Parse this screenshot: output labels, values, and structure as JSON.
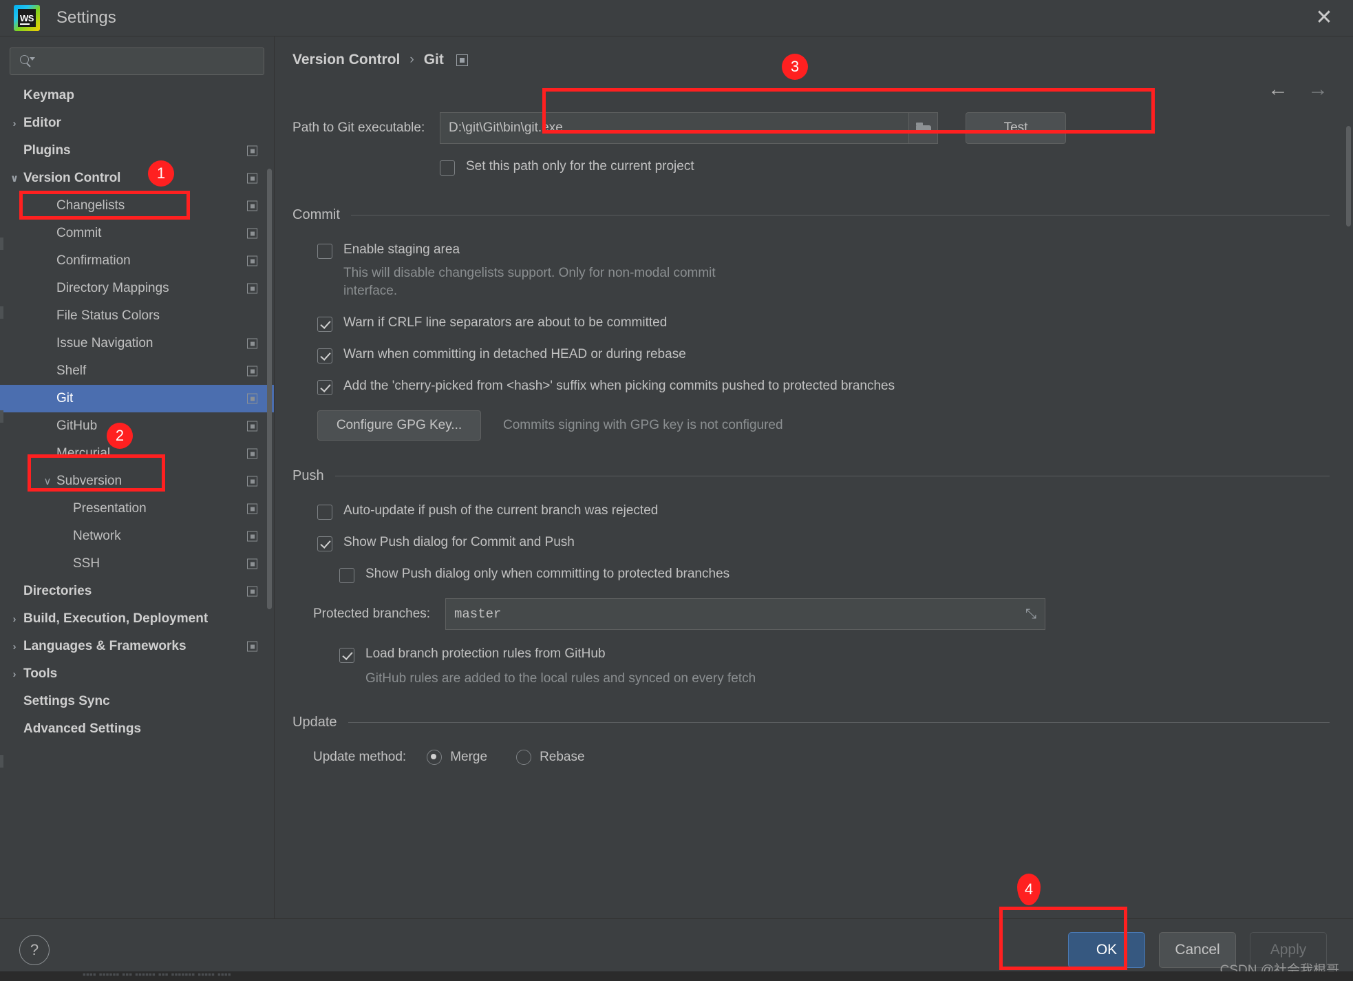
{
  "window": {
    "title": "Settings",
    "logo_text": "WS",
    "close_icon": "✕"
  },
  "sidebar": {
    "search": {
      "placeholder": "",
      "value": "",
      "icon": "search-icon"
    },
    "items": [
      {
        "label": "Keymap",
        "indent": 0,
        "arrow": "",
        "bold": true,
        "cfg": false,
        "selected": false
      },
      {
        "label": "Editor",
        "indent": 0,
        "arrow": "›",
        "bold": true,
        "cfg": false,
        "selected": false
      },
      {
        "label": "Plugins",
        "indent": 0,
        "arrow": "",
        "bold": true,
        "cfg": true,
        "selected": false
      },
      {
        "label": "Version Control",
        "indent": 0,
        "arrow": "∨",
        "bold": true,
        "cfg": true,
        "selected": false
      },
      {
        "label": "Changelists",
        "indent": 1,
        "arrow": "",
        "bold": false,
        "cfg": true,
        "selected": false
      },
      {
        "label": "Commit",
        "indent": 1,
        "arrow": "",
        "bold": false,
        "cfg": true,
        "selected": false
      },
      {
        "label": "Confirmation",
        "indent": 1,
        "arrow": "",
        "bold": false,
        "cfg": true,
        "selected": false
      },
      {
        "label": "Directory Mappings",
        "indent": 1,
        "arrow": "",
        "bold": false,
        "cfg": true,
        "selected": false
      },
      {
        "label": "File Status Colors",
        "indent": 1,
        "arrow": "",
        "bold": false,
        "cfg": false,
        "selected": false
      },
      {
        "label": "Issue Navigation",
        "indent": 1,
        "arrow": "",
        "bold": false,
        "cfg": true,
        "selected": false
      },
      {
        "label": "Shelf",
        "indent": 1,
        "arrow": "",
        "bold": false,
        "cfg": true,
        "selected": false
      },
      {
        "label": "Git",
        "indent": 1,
        "arrow": "",
        "bold": false,
        "cfg": true,
        "selected": true
      },
      {
        "label": "GitHub",
        "indent": 1,
        "arrow": "",
        "bold": false,
        "cfg": true,
        "selected": false
      },
      {
        "label": "Mercurial",
        "indent": 1,
        "arrow": "",
        "bold": false,
        "cfg": true,
        "selected": false
      },
      {
        "label": "Subversion",
        "indent": 1,
        "arrow": "∨",
        "bold": false,
        "cfg": true,
        "selected": false
      },
      {
        "label": "Presentation",
        "indent": 2,
        "arrow": "",
        "bold": false,
        "cfg": true,
        "selected": false
      },
      {
        "label": "Network",
        "indent": 2,
        "arrow": "",
        "bold": false,
        "cfg": true,
        "selected": false
      },
      {
        "label": "SSH",
        "indent": 2,
        "arrow": "",
        "bold": false,
        "cfg": true,
        "selected": false
      },
      {
        "label": "Directories",
        "indent": 0,
        "arrow": "",
        "bold": true,
        "cfg": true,
        "selected": false
      },
      {
        "label": "Build, Execution, Deployment",
        "indent": 0,
        "arrow": "›",
        "bold": true,
        "cfg": false,
        "selected": false
      },
      {
        "label": "Languages & Frameworks",
        "indent": 0,
        "arrow": "›",
        "bold": true,
        "cfg": true,
        "selected": false
      },
      {
        "label": "Tools",
        "indent": 0,
        "arrow": "›",
        "bold": true,
        "cfg": false,
        "selected": false
      },
      {
        "label": "Settings Sync",
        "indent": 0,
        "arrow": "",
        "bold": true,
        "cfg": false,
        "selected": false
      },
      {
        "label": "Advanced Settings",
        "indent": 0,
        "arrow": "",
        "bold": true,
        "cfg": false,
        "selected": false
      }
    ]
  },
  "main": {
    "breadcrumb": {
      "parent": "Version Control",
      "separator": "›",
      "current": "Git"
    },
    "nav": {
      "back_icon": "←",
      "forward_icon": "→"
    },
    "path": {
      "label_prefix": "P",
      "label_rest": "ath to Git executable:",
      "value": "D:\\git\\Git\\bin\\git.exe",
      "placeholder": "",
      "browse_icon": "folder-icon",
      "test_label": "Test"
    },
    "set_path_only_current_project": {
      "label": "Set this path only for the current project",
      "checked": false
    },
    "commit": {
      "section_title": "Commit",
      "enable_staging": {
        "label": "Enable staging area",
        "checked": false
      },
      "enable_staging_hint": "This will disable changelists support. Only for non-modal commit interface.",
      "warn_crlf": {
        "label": "Warn if CRLF line separators are about to be committed",
        "checked": true
      },
      "warn_detached": {
        "label": "Warn when committing in detached HEAD or during rebase",
        "checked": true
      },
      "cherry_pick": {
        "label": "Add the 'cherry-picked from <hash>' suffix when picking commits pushed to protected branches",
        "checked": true
      },
      "gpg_button": "Configure GPG Key...",
      "gpg_status": "Commits signing with GPG key is not configured"
    },
    "push": {
      "section_title": "Push",
      "auto_update": {
        "label": "Auto-update if push of the current branch was rejected",
        "checked": false
      },
      "show_push_dialog": {
        "label": "Show Push dialog for Commit and Push",
        "checked": true
      },
      "show_push_protected": {
        "label": "Show Push dialog only when committing to protected branches",
        "checked": false
      },
      "protected_branches_label": "Protected branches:",
      "protected_branches_value": "master",
      "expand_icon": "⤡",
      "load_branch_rules": {
        "label": "Load branch protection rules from GitHub",
        "checked": true
      },
      "load_branch_rules_hint": "GitHub rules are added to the local rules and synced on every fetch"
    },
    "update": {
      "section_title": "Update",
      "method_label": "Update method:",
      "options": [
        {
          "label": "Merge",
          "selected": true
        },
        {
          "label": "Rebase",
          "selected": false
        }
      ]
    }
  },
  "footer": {
    "help_label": "?",
    "ok_label": "OK",
    "cancel_label": "Cancel",
    "apply_label": "Apply",
    "watermark": "CSDN @社会我根哥"
  },
  "annotations": [
    {
      "number": "1"
    },
    {
      "number": "2"
    },
    {
      "number": "3"
    },
    {
      "number": "4"
    }
  ],
  "colors": {
    "accent_selected": "#4b6eaf",
    "primary_button": "#365880",
    "annotation_red": "#ff2020",
    "panel_bg": "#3c3f41",
    "field_bg": "#45494a"
  }
}
